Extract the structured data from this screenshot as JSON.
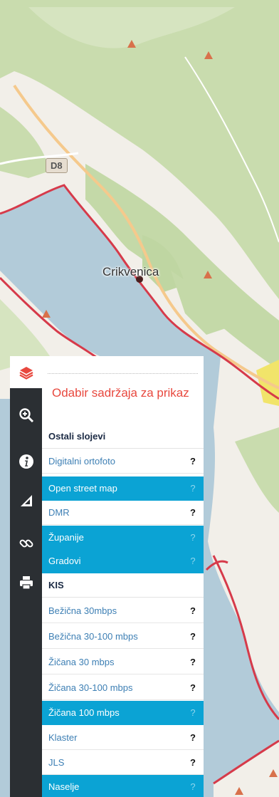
{
  "map": {
    "place_label": "Crikvenica",
    "road_shield": "D8",
    "colors": {
      "sea": "#b2cbd9",
      "land": "#f2efe9",
      "forest": "#c9dcae",
      "border": "#d63a4a",
      "road": "#f5c98c"
    }
  },
  "toolbar": {
    "items": [
      {
        "icon": "layers-icon",
        "active": true
      },
      {
        "icon": "zoom-in-icon"
      },
      {
        "icon": "info-icon"
      },
      {
        "icon": "measure-icon"
      },
      {
        "icon": "link-icon"
      },
      {
        "icon": "print-icon"
      }
    ]
  },
  "panel": {
    "title": "Odabir sadržaja za prikaz",
    "sections": [
      {
        "header": "Ostali slojevi",
        "items": [
          {
            "label": "Digitalni ortofoto",
            "help": "?",
            "active": false
          },
          {
            "label": "Open street map",
            "help": "?",
            "active": true
          },
          {
            "label": "DMR",
            "help": "?",
            "active": false
          },
          {
            "label": "Županije",
            "help": "?",
            "active": true
          },
          {
            "label": "Gradovi",
            "help": "?",
            "active": true
          }
        ]
      },
      {
        "header": "KIS",
        "items": [
          {
            "label": "Bežična 30mbps",
            "help": "?",
            "active": false
          },
          {
            "label": "Bežična 30-100 mbps",
            "help": "?",
            "active": false
          },
          {
            "label": "Žičana 30 mbps",
            "help": "?",
            "active": false
          },
          {
            "label": "Žičana 30-100 mbps",
            "help": "?",
            "active": false
          },
          {
            "label": "Žičana 100 mbps",
            "help": "?",
            "active": true
          },
          {
            "label": "Klaster",
            "help": "?",
            "active": false
          },
          {
            "label": "JLS",
            "help": "?",
            "active": false
          },
          {
            "label": "Naselje",
            "help": "?",
            "active": true
          }
        ]
      }
    ]
  }
}
